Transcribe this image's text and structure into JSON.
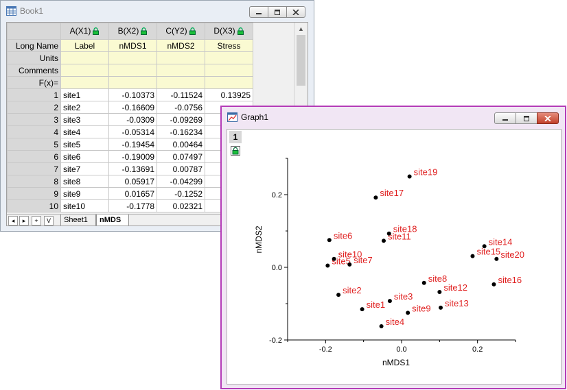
{
  "book": {
    "title": "Book1",
    "columns": [
      {
        "header": "A(X1)"
      },
      {
        "header": "B(X2)"
      },
      {
        "header": "C(Y2)"
      },
      {
        "header": "D(X3)"
      }
    ],
    "meta_rows": [
      {
        "label": "Long Name",
        "values": [
          "Label",
          "nMDS1",
          "nMDS2",
          "Stress"
        ]
      },
      {
        "label": "Units",
        "values": [
          "",
          "",
          "",
          ""
        ]
      },
      {
        "label": "Comments",
        "values": [
          "",
          "",
          "",
          ""
        ]
      },
      {
        "label": "F(x)=",
        "values": [
          "",
          "",
          "",
          ""
        ]
      }
    ],
    "rows": [
      {
        "n": "1",
        "values": [
          "site1",
          "-0.10373",
          "-0.11524",
          "0.13925"
        ]
      },
      {
        "n": "2",
        "values": [
          "site2",
          "-0.16609",
          "-0.0756",
          ""
        ]
      },
      {
        "n": "3",
        "values": [
          "site3",
          "-0.0309",
          "-0.09269",
          ""
        ]
      },
      {
        "n": "4",
        "values": [
          "site4",
          "-0.05314",
          "-0.16234",
          ""
        ]
      },
      {
        "n": "5",
        "values": [
          "site5",
          "-0.19454",
          "0.00464",
          ""
        ]
      },
      {
        "n": "6",
        "values": [
          "site6",
          "-0.19009",
          "0.07497",
          ""
        ]
      },
      {
        "n": "7",
        "values": [
          "site7",
          "-0.13691",
          "0.00787",
          ""
        ]
      },
      {
        "n": "8",
        "values": [
          "site8",
          "0.05917",
          "-0.04299",
          ""
        ]
      },
      {
        "n": "9",
        "values": [
          "site9",
          "0.01657",
          "-0.1252",
          ""
        ]
      },
      {
        "n": "10",
        "values": [
          "site10",
          "-0.1778",
          "0.02321",
          ""
        ]
      }
    ],
    "sheet_tabs": [
      "Sheet1",
      "nMDS"
    ],
    "active_sheet": "nMDS",
    "nav_buttons": [
      "◂",
      "▸",
      "+",
      "V"
    ]
  },
  "graph": {
    "title": "Graph1",
    "layer": "1"
  },
  "chart_data": {
    "type": "scatter",
    "xlabel": "nMDS1",
    "ylabel": "nMDS2",
    "xlim": [
      -0.3,
      0.3
    ],
    "ylim": [
      -0.2,
      0.3
    ],
    "xticks": [
      -0.2,
      0.0,
      0.2
    ],
    "xtick_labels": [
      "-0.2",
      "0.0",
      "0.2"
    ],
    "yticks": [
      -0.2,
      0.0,
      0.2
    ],
    "ytick_labels": [
      "-0.2",
      "0.0",
      "0.2"
    ],
    "point_color": "#000000",
    "label_color": "#e02020",
    "points": [
      {
        "label": "site1",
        "x": -0.10373,
        "y": -0.11524
      },
      {
        "label": "site2",
        "x": -0.16609,
        "y": -0.0756
      },
      {
        "label": "site3",
        "x": -0.0309,
        "y": -0.09269
      },
      {
        "label": "site4",
        "x": -0.05314,
        "y": -0.16234
      },
      {
        "label": "site5",
        "x": -0.19454,
        "y": 0.00464
      },
      {
        "label": "site6",
        "x": -0.19009,
        "y": 0.07497
      },
      {
        "label": "site7",
        "x": -0.13691,
        "y": 0.00787
      },
      {
        "label": "site8",
        "x": 0.05917,
        "y": -0.04299
      },
      {
        "label": "site9",
        "x": 0.01657,
        "y": -0.1252
      },
      {
        "label": "site10",
        "x": -0.1778,
        "y": 0.02321
      },
      {
        "label": "site11",
        "x": -0.047,
        "y": 0.073
      },
      {
        "label": "site12",
        "x": 0.1,
        "y": -0.068
      },
      {
        "label": "site13",
        "x": 0.103,
        "y": -0.111
      },
      {
        "label": "site14",
        "x": 0.218,
        "y": 0.058
      },
      {
        "label": "site15",
        "x": 0.187,
        "y": 0.031
      },
      {
        "label": "site16",
        "x": 0.243,
        "y": -0.047
      },
      {
        "label": "site17",
        "x": -0.068,
        "y": 0.192
      },
      {
        "label": "site18",
        "x": -0.033,
        "y": 0.093
      },
      {
        "label": "site19",
        "x": 0.021,
        "y": 0.25
      },
      {
        "label": "site20",
        "x": 0.25,
        "y": 0.023
      }
    ]
  }
}
